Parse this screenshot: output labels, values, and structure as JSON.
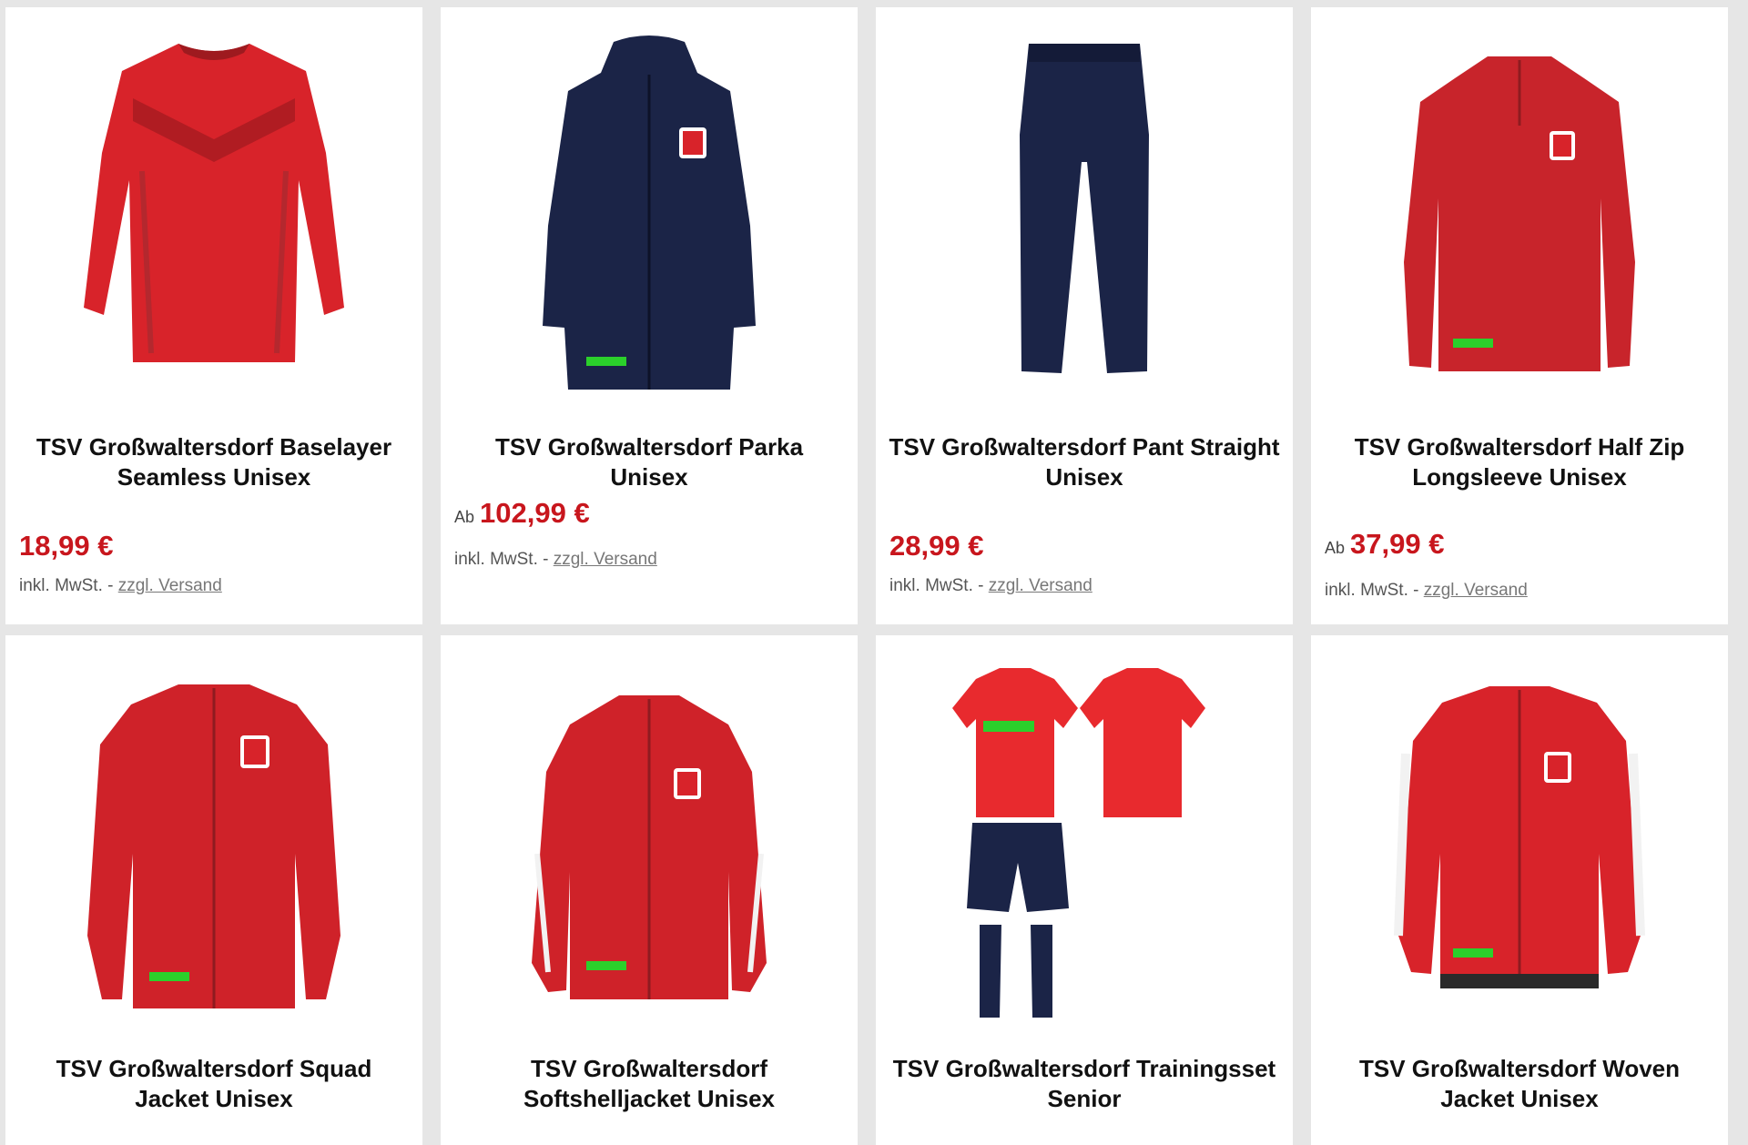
{
  "products": [
    {
      "title": "TSV Großwaltersdorf Baselayer Seamless Unisex",
      "from": "",
      "price": "18,99 €",
      "tax": "inkl. MwSt. -",
      "shipping": "zzgl. Versand"
    },
    {
      "title": "TSV Großwaltersdorf Parka Unisex",
      "from": "Ab",
      "price": "102,99 €",
      "tax": "inkl. MwSt. -",
      "shipping": "zzgl. Versand"
    },
    {
      "title": "TSV Großwaltersdorf Pant Straight Unisex",
      "from": "",
      "price": "28,99 €",
      "tax": "inkl. MwSt. -",
      "shipping": "zzgl. Versand"
    },
    {
      "title": "TSV Großwaltersdorf Half Zip Longsleeve Unisex",
      "from": "Ab",
      "price": "37,99 €",
      "tax": "inkl. MwSt. -",
      "shipping": "zzgl. Versand"
    },
    {
      "title": "TSV Großwaltersdorf Squad Jacket Unisex"
    },
    {
      "title": "TSV Großwaltersdorf Softshelljacket Unisex"
    },
    {
      "title": "TSV Großwaltersdorf Trainingsset Senior"
    },
    {
      "title": "TSV Großwaltersdorf Woven Jacket Unisex"
    }
  ],
  "colors": {
    "price": "#c8161d",
    "red": "#d8232a",
    "navy": "#1b2447",
    "background": "#e6e6e6"
  }
}
